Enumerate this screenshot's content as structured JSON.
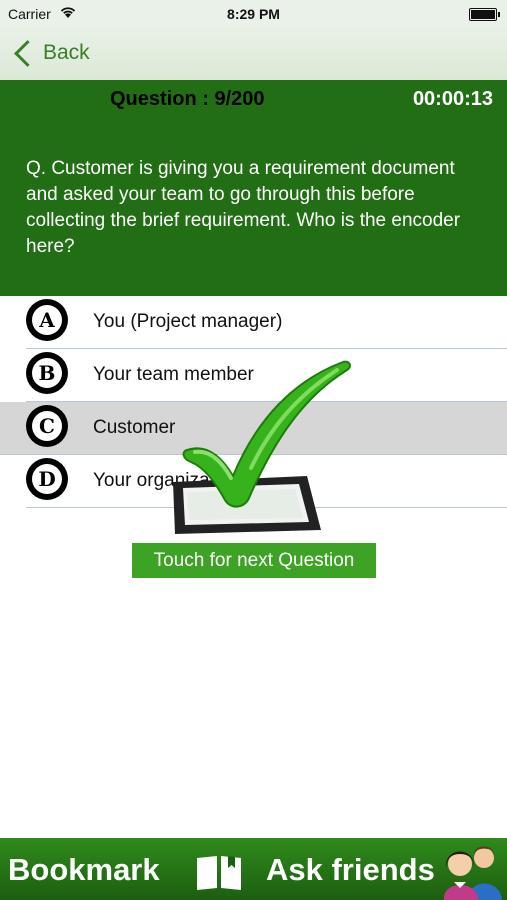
{
  "status_bar": {
    "carrier": "Carrier",
    "time": "8:29 PM"
  },
  "nav": {
    "back_label": "Back"
  },
  "question": {
    "number": "Question : 9/200",
    "timer": "00:00:13",
    "text": "Q. Customer is giving you a requirement document and asked your team to go through this before collecting the brief requirement. Who is the encoder here?"
  },
  "options": [
    {
      "letter": "A",
      "text": "You (Project manager)"
    },
    {
      "letter": "B",
      "text": "Your team member"
    },
    {
      "letter": "C",
      "text": "Customer"
    },
    {
      "letter": "D",
      "text": "Your organization"
    }
  ],
  "selected_option": "C",
  "next_button": "Touch for next Question",
  "footer": {
    "bookmark": "Bookmark",
    "ask_friends": "Ask friends"
  },
  "colors": {
    "header_green": "#226e14",
    "button_green": "#3da324",
    "accent_green": "#3a7e2a"
  },
  "icons": [
    "wifi-icon",
    "battery-icon",
    "back-chevron-icon",
    "correct-checkmark-icon",
    "book-icon",
    "friends-icon"
  ]
}
